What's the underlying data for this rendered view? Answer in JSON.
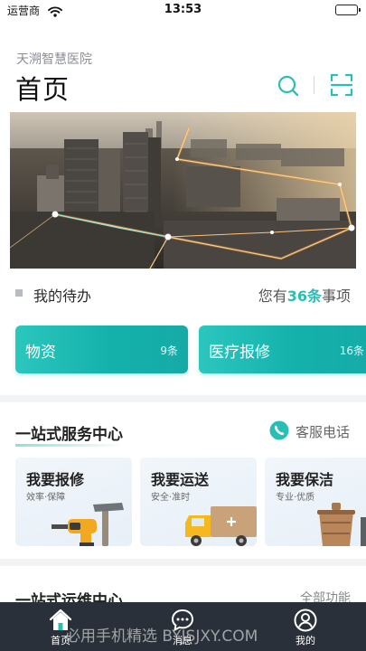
{
  "status_bar": {
    "carrier": "运营商",
    "time": "13:53",
    "battery_level": 1.0
  },
  "header": {
    "hospital_name": "天溯智慧医院",
    "title": "首页",
    "search_icon": "search-icon",
    "scan_icon": "scan-icon"
  },
  "todo": {
    "label": "我的待办",
    "summary_prefix": "您有",
    "summary_count": "36条",
    "summary_suffix": "事项",
    "cards": [
      {
        "name": "物资",
        "count": "9条"
      },
      {
        "name": "医疗报修",
        "count": "16条"
      }
    ]
  },
  "service_center": {
    "title": "一站式服务中心",
    "hotline_label": "客服电话",
    "hotline_icon": "phone-icon",
    "cards": [
      {
        "title": "我要报修",
        "sub": "效率·保障",
        "icon": "drill-hammer-icon"
      },
      {
        "title": "我要运送",
        "sub": "安全·准时",
        "icon": "truck-icon"
      },
      {
        "title": "我要保洁",
        "sub": "专业·优质",
        "icon": "bucket-icon"
      }
    ]
  },
  "ops_center": {
    "title": "一站式运维中心",
    "more_label": "全部功能"
  },
  "tab_bar": {
    "tabs": [
      {
        "label": "首页",
        "icon": "home-icon",
        "active": true
      },
      {
        "label": "消息",
        "icon": "message-icon",
        "active": false
      },
      {
        "label": "我的",
        "icon": "user-icon",
        "active": false
      }
    ]
  },
  "watermark": "必用手机精选 BYJSJXY.COM",
  "colors": {
    "accent": "#2abfb6",
    "tab_bar_bg": "#2a3039",
    "section_sep": "#f2f3f5"
  }
}
